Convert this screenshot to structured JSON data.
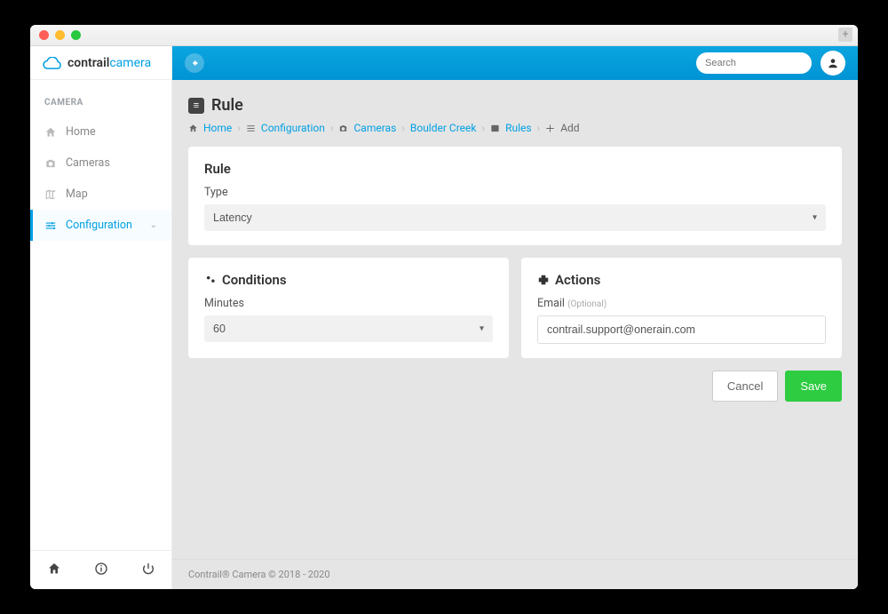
{
  "logo": {
    "part1": "contrail",
    "part2": "camera"
  },
  "sidebar": {
    "section": "CAMERA",
    "items": [
      {
        "label": "Home",
        "icon": "home-icon"
      },
      {
        "label": "Cameras",
        "icon": "camera-icon"
      },
      {
        "label": "Map",
        "icon": "map-icon"
      },
      {
        "label": "Configuration",
        "icon": "sliders-icon",
        "active": true,
        "expandable": true
      }
    ]
  },
  "search": {
    "placeholder": "Search"
  },
  "page": {
    "title": "Rule"
  },
  "breadcrumb": {
    "home": "Home",
    "configuration": "Configuration",
    "cameras": "Cameras",
    "boulder_creek": "Boulder Creek",
    "rules": "Rules",
    "add": "Add"
  },
  "rule_card": {
    "heading": "Rule",
    "type_label": "Type",
    "type_value": "Latency"
  },
  "conditions_card": {
    "heading": "Conditions",
    "minutes_label": "Minutes",
    "minutes_value": "60"
  },
  "actions_card": {
    "heading": "Actions",
    "email_label": "Email",
    "email_optional": "(Optional)",
    "email_value": "contrail.support@onerain.com"
  },
  "buttons": {
    "cancel": "Cancel",
    "save": "Save"
  },
  "footer": "Contrail® Camera © 2018 - 2020"
}
